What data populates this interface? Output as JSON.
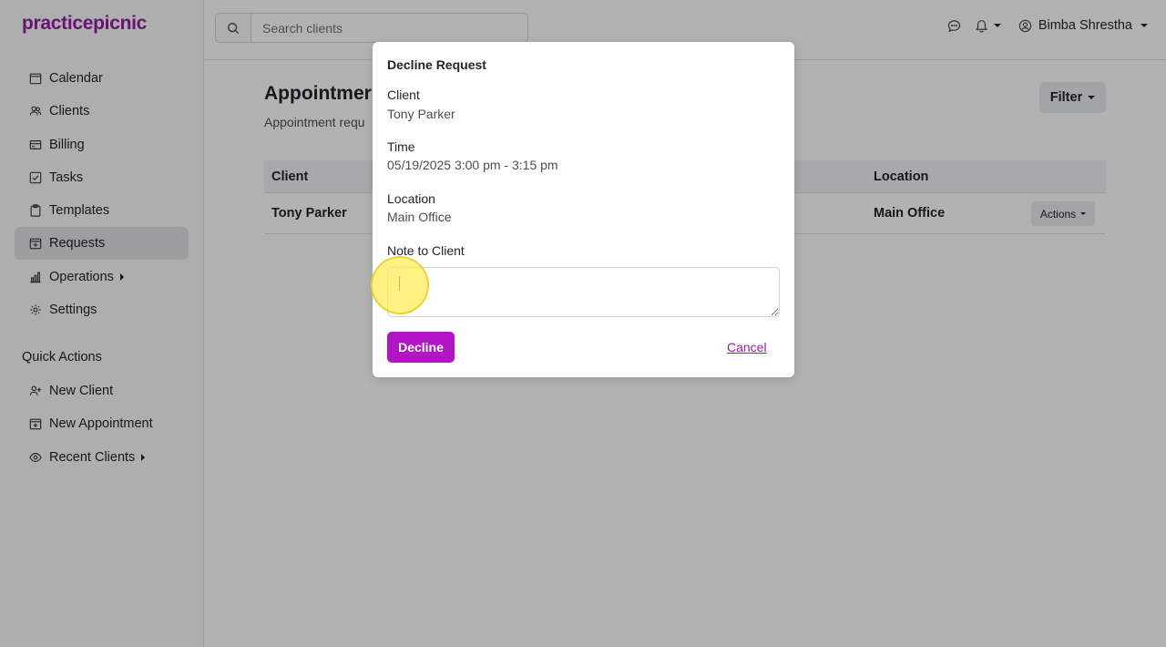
{
  "app": {
    "logo": "practicepicnic",
    "brand_color": "#9b1aa8"
  },
  "sidebar": {
    "items": [
      {
        "label": "Calendar",
        "icon": "calendar-icon"
      },
      {
        "label": "Clients",
        "icon": "users-icon"
      },
      {
        "label": "Billing",
        "icon": "credit-card-icon"
      },
      {
        "label": "Tasks",
        "icon": "checkbox-icon"
      },
      {
        "label": "Templates",
        "icon": "clipboard-icon"
      },
      {
        "label": "Requests",
        "icon": "calendar-plus-icon",
        "active": true
      },
      {
        "label": "Operations",
        "icon": "bar-chart-icon",
        "has_submenu": true
      },
      {
        "label": "Settings",
        "icon": "gear-icon"
      }
    ],
    "quick_actions_title": "Quick Actions",
    "quick_actions": [
      {
        "label": "New Client",
        "icon": "person-add-icon"
      },
      {
        "label": "New Appointment",
        "icon": "calendar-plus-icon"
      },
      {
        "label": "Recent Clients",
        "icon": "eye-icon",
        "has_submenu": true
      }
    ]
  },
  "topbar": {
    "search_placeholder": "Search clients",
    "user_name": "Bimba Shrestha"
  },
  "main": {
    "title": "Appointmer",
    "subtitle": "Appointment requ",
    "filter_label": "Filter",
    "table": {
      "headers": {
        "client": "Client",
        "location": "Location"
      },
      "rows": [
        {
          "client": "Tony Parker",
          "location": "Main Office",
          "actions_label": "Actions"
        }
      ]
    }
  },
  "modal": {
    "title": "Decline Request",
    "client_label": "Client",
    "client_value": "Tony Parker",
    "time_label": "Time",
    "time_value": "05/19/2025 3:00 pm - 3:15 pm",
    "location_label": "Location",
    "location_value": "Main Office",
    "note_label": "Note to Client",
    "note_value": "",
    "decline_label": "Decline",
    "cancel_label": "Cancel"
  }
}
